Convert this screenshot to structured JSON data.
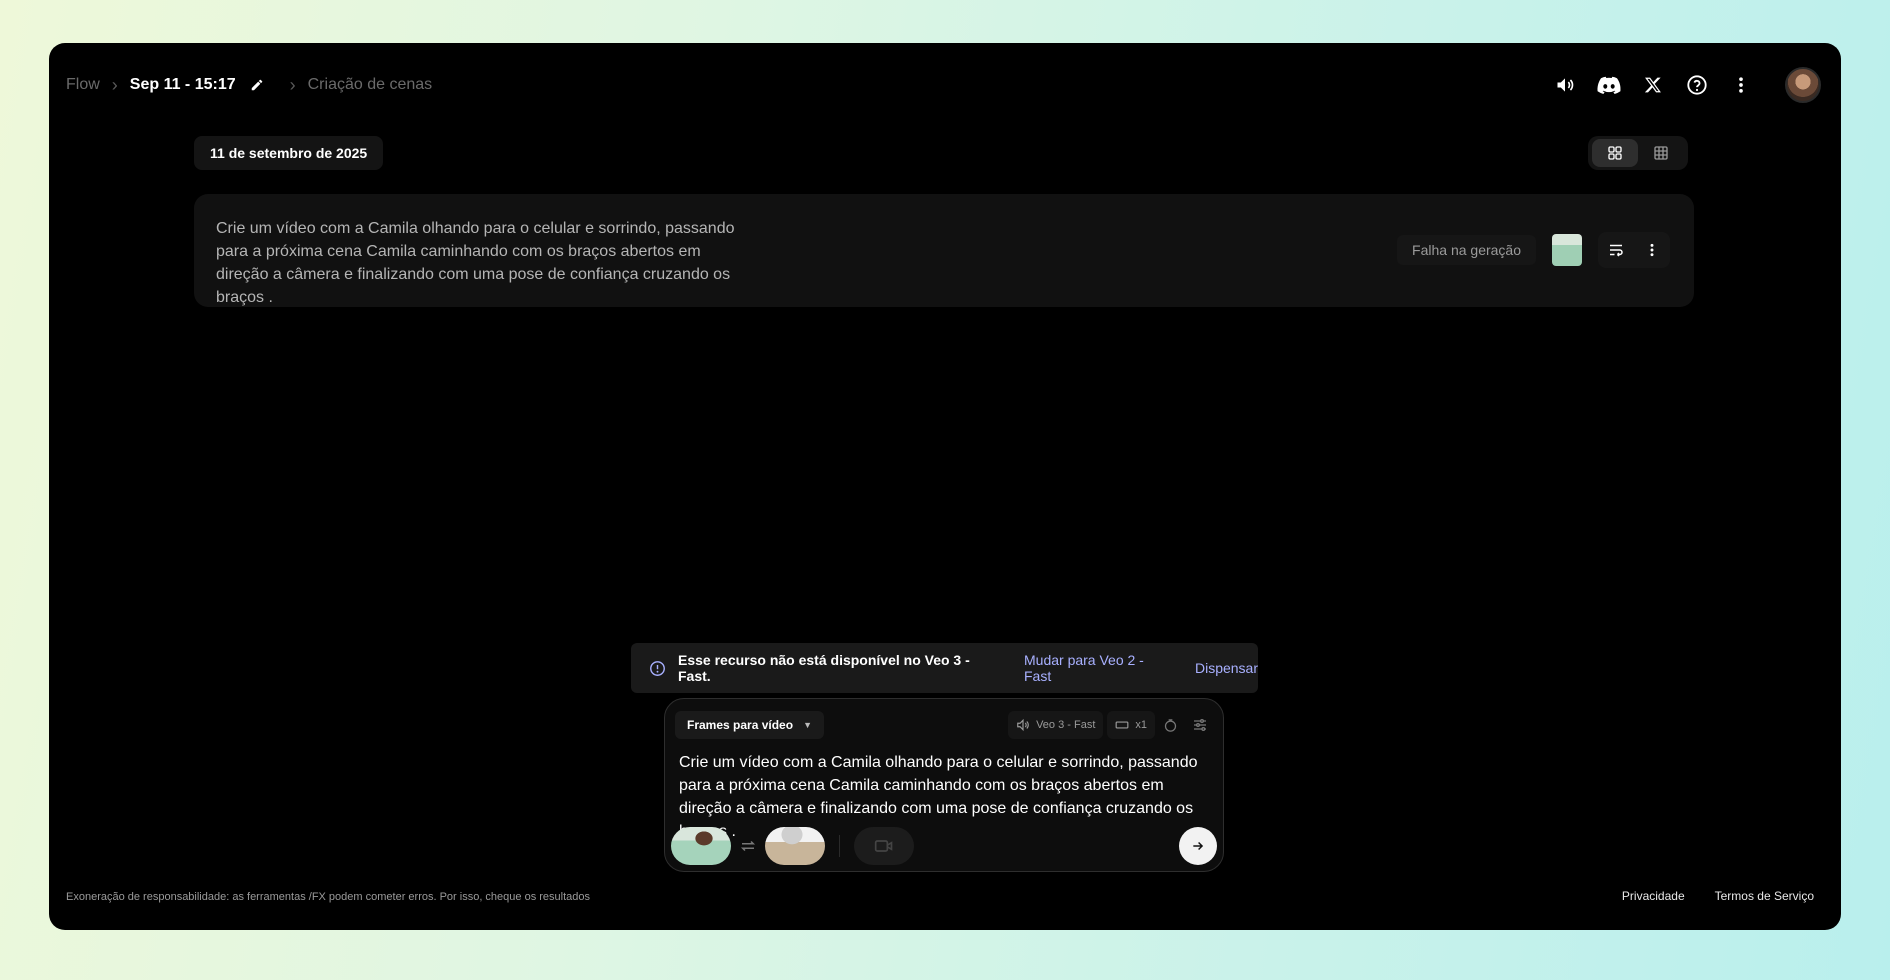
{
  "breadcrumb": {
    "root": "Flow",
    "project": "Sep 11 - 15:17",
    "page": "Criação de cenas"
  },
  "header_icons": [
    "volume-icon",
    "discord-icon",
    "x-icon",
    "help-icon",
    "more-vert-icon"
  ],
  "date_chip": "11 de setembro de 2025",
  "view_toggle": {
    "selected": "grid"
  },
  "card": {
    "prompt": "Crie um vídeo com a Camila olhando para o celular e sorrindo, passando para a próxima cena Camila caminhando com os braços abertos em direção a câmera e finalizando com uma pose de confiança cruzando os braços .",
    "status": "Falha na geração"
  },
  "alert": {
    "message": "Esse recurso não está disponível no Veo 3 - Fast.",
    "action": "Mudar para Veo 2 - Fast",
    "dismiss": "Dispensar"
  },
  "composer": {
    "mode": "Frames para vídeo",
    "model": "Veo 3 - Fast",
    "count": "x1",
    "prompt": "Crie um vídeo com a Camila olhando para o celular e sorrindo, passando para a próxima cena Camila caminhando com os braços abertos em direção a câmera  e finalizando com uma pose de confiança cruzando os braços ."
  },
  "footer": {
    "disclaimer": "Exoneração de responsabilidade: as ferramentas /FX podem cometer erros. Por isso, cheque os resultados",
    "privacy": "Privacidade",
    "terms": "Termos de Serviço"
  },
  "colors": {
    "accent_link": "#a8b0ff",
    "background": "#000000"
  }
}
